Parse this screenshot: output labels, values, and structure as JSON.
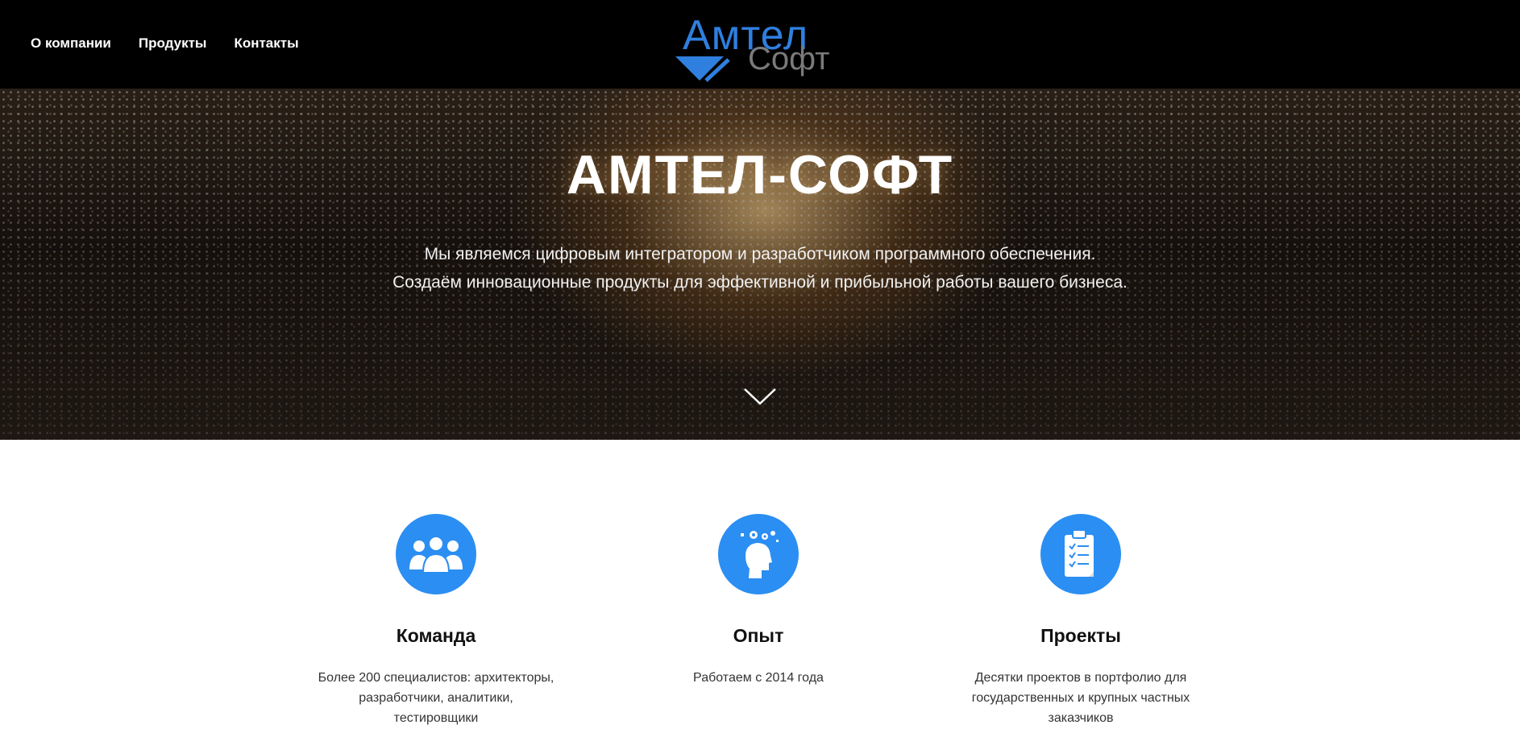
{
  "nav": {
    "items": [
      {
        "label": "О компании"
      },
      {
        "label": "Продукты"
      },
      {
        "label": "Контакты"
      }
    ]
  },
  "logo": {
    "line1": "Амтел",
    "line2": "Софт",
    "accent_color": "#2f7fde"
  },
  "hero": {
    "title": "АМТЕЛ-СОФТ",
    "subtitle_line1": "Мы являемся цифровым интегратором и разработчиком программного обеспечения.",
    "subtitle_line2": "Создаём инновационные продукты для эффективной и прибыльной работы вашего бизнеса.",
    "scroll_icon": "chevron-down-icon"
  },
  "features": [
    {
      "icon": "team-icon",
      "title": "Команда",
      "text_line1": "Более 200 специалистов: архитекторы,",
      "text_line2": "разработчики, аналитики, тестировщики"
    },
    {
      "icon": "head-gears-icon",
      "title": "Опыт",
      "text_line1": "Работаем с 2014 года"
    },
    {
      "icon": "clipboard-checklist-icon",
      "title": "Проекты",
      "text_line1": "Десятки проектов в портфолио для",
      "text_line2": "государственных и крупных частных",
      "text_line3": "заказчиков"
    }
  ],
  "colors": {
    "header_bg": "#000000",
    "brand_blue": "#2b8ef2",
    "text_dark": "#111111"
  }
}
